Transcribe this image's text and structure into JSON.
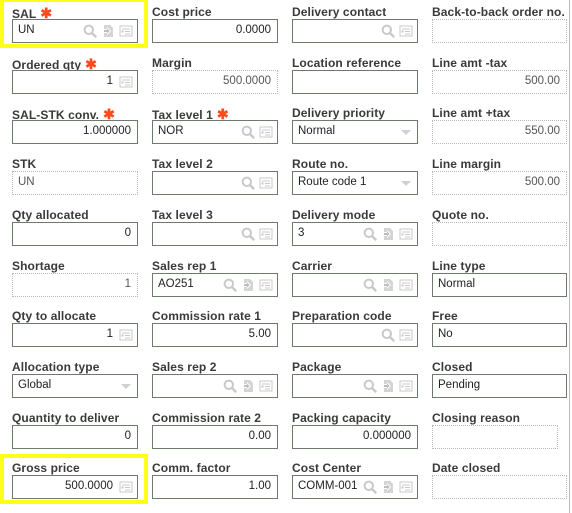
{
  "colors": {
    "highlight": "#ffff1a",
    "required": "#ff4a1c",
    "label": "#3a3a3a",
    "border": "#6e7a6e"
  },
  "fields": [
    {
      "label": "SAL",
      "required": true,
      "value": "UN",
      "align": "left",
      "readonly": false,
      "icons": [
        "search-icon",
        "link-icon",
        "detail-icon"
      ],
      "highlighted": true
    },
    {
      "label": "Cost price",
      "required": false,
      "value": "0.0000",
      "align": "right",
      "readonly": false,
      "icons": []
    },
    {
      "label": "Delivery contact",
      "required": false,
      "value": "",
      "align": "left",
      "readonly": false,
      "icons": [
        "search-icon",
        "detail-icon"
      ]
    },
    {
      "label": "Back-to-back order no.",
      "required": false,
      "value": "",
      "align": "left",
      "readonly": true,
      "icons": [],
      "wide": true
    },
    {
      "label": "Ordered qty",
      "required": true,
      "value": "1",
      "align": "right",
      "readonly": false,
      "icons": [
        "detail-icon"
      ]
    },
    {
      "label": "Margin",
      "required": false,
      "value": "500.0000",
      "align": "right",
      "readonly": true,
      "icons": []
    },
    {
      "label": "Location reference",
      "required": false,
      "value": "",
      "align": "left",
      "readonly": false,
      "icons": []
    },
    {
      "label": "Line amt -tax",
      "required": false,
      "value": "500.00",
      "align": "right",
      "readonly": true,
      "icons": [],
      "wide": true
    },
    {
      "label": "SAL-STK conv.",
      "required": true,
      "value": "1.000000",
      "align": "right",
      "readonly": false,
      "icons": []
    },
    {
      "label": "Tax level 1",
      "required": true,
      "value": "NOR",
      "align": "left",
      "readonly": false,
      "icons": [
        "search-icon",
        "detail-icon"
      ]
    },
    {
      "label": "Delivery priority",
      "required": false,
      "value": "Normal",
      "align": "left",
      "readonly": false,
      "icons": [
        "dropdown-arrow-icon"
      ]
    },
    {
      "label": "Line amt +tax",
      "required": false,
      "value": "550.00",
      "align": "right",
      "readonly": true,
      "icons": [],
      "wide": true
    },
    {
      "label": "STK",
      "required": false,
      "value": "UN",
      "align": "left",
      "readonly": true,
      "icons": []
    },
    {
      "label": "Tax level 2",
      "required": false,
      "value": "",
      "align": "left",
      "readonly": false,
      "icons": [
        "search-icon",
        "detail-icon"
      ]
    },
    {
      "label": "Route no.",
      "required": false,
      "value": "Route code 1",
      "align": "left",
      "readonly": false,
      "icons": [
        "dropdown-arrow-icon"
      ]
    },
    {
      "label": "Line margin",
      "required": false,
      "value": "500.00",
      "align": "right",
      "readonly": true,
      "icons": [],
      "wide": true
    },
    {
      "label": "Qty allocated",
      "required": false,
      "value": "0",
      "align": "right",
      "readonly": false,
      "icons": []
    },
    {
      "label": "Tax level 3",
      "required": false,
      "value": "",
      "align": "left",
      "readonly": false,
      "icons": [
        "search-icon",
        "detail-icon"
      ]
    },
    {
      "label": "Delivery mode",
      "required": false,
      "value": "3",
      "align": "left",
      "readonly": false,
      "icons": [
        "search-icon",
        "link-icon",
        "detail-icon"
      ]
    },
    {
      "label": "Quote no.",
      "required": false,
      "value": "",
      "align": "left",
      "readonly": true,
      "icons": [],
      "wide": true
    },
    {
      "label": "Shortage",
      "required": false,
      "value": "1",
      "align": "right",
      "readonly": true,
      "icons": []
    },
    {
      "label": "Sales rep 1",
      "required": false,
      "value": "AO251",
      "align": "left",
      "readonly": false,
      "icons": [
        "search-icon",
        "link-icon",
        "detail-icon"
      ]
    },
    {
      "label": "Carrier",
      "required": false,
      "value": "",
      "align": "left",
      "readonly": false,
      "icons": [
        "search-icon",
        "link-icon",
        "detail-icon"
      ]
    },
    {
      "label": "Line type",
      "required": false,
      "value": "Normal",
      "align": "left",
      "readonly": false,
      "icons": [],
      "wide": true
    },
    {
      "label": "Qty to allocate",
      "required": false,
      "value": "1",
      "align": "right",
      "readonly": false,
      "icons": [
        "detail-icon"
      ]
    },
    {
      "label": "Commission rate 1",
      "required": false,
      "value": "5.00",
      "align": "right",
      "readonly": false,
      "icons": []
    },
    {
      "label": "Preparation code",
      "required": false,
      "value": "",
      "align": "left",
      "readonly": false,
      "icons": [
        "search-icon",
        "detail-icon"
      ]
    },
    {
      "label": "Free",
      "required": false,
      "value": "No",
      "align": "left",
      "readonly": false,
      "icons": [],
      "wide": true
    },
    {
      "label": "Allocation type",
      "required": false,
      "value": "Global",
      "align": "left",
      "readonly": false,
      "icons": [
        "dropdown-arrow-icon"
      ]
    },
    {
      "label": "Sales rep 2",
      "required": false,
      "value": "",
      "align": "left",
      "readonly": false,
      "icons": [
        "search-icon",
        "link-icon",
        "detail-icon"
      ]
    },
    {
      "label": "Package",
      "required": false,
      "value": "",
      "align": "left",
      "readonly": false,
      "icons": [
        "search-icon",
        "link-icon",
        "detail-icon"
      ]
    },
    {
      "label": "Closed",
      "required": false,
      "value": "Pending",
      "align": "left",
      "readonly": false,
      "icons": [],
      "wide": true
    },
    {
      "label": "Quantity to deliver",
      "required": false,
      "value": "0",
      "align": "right",
      "readonly": false,
      "icons": []
    },
    {
      "label": "Commission rate 2",
      "required": false,
      "value": "0.00",
      "align": "right",
      "readonly": false,
      "icons": []
    },
    {
      "label": "Packing capacity",
      "required": false,
      "value": "0.000000",
      "align": "right",
      "readonly": false,
      "icons": []
    },
    {
      "label": "Closing reason",
      "required": false,
      "value": "",
      "align": "left",
      "readonly": true,
      "icons": []
    },
    {
      "label": "Gross price",
      "required": false,
      "value": "500.0000",
      "align": "right",
      "readonly": false,
      "icons": [
        "detail-icon"
      ],
      "highlighted": true
    },
    {
      "label": "Comm. factor",
      "required": false,
      "value": "1.00",
      "align": "right",
      "readonly": false,
      "icons": []
    },
    {
      "label": "Cost Center",
      "required": false,
      "value": "COMM-001",
      "align": "left",
      "readonly": false,
      "icons": [
        "search-icon",
        "link-icon",
        "detail-icon"
      ]
    },
    {
      "label": "Date closed",
      "required": false,
      "value": "",
      "align": "left",
      "readonly": true,
      "icons": [],
      "wide": true
    }
  ]
}
